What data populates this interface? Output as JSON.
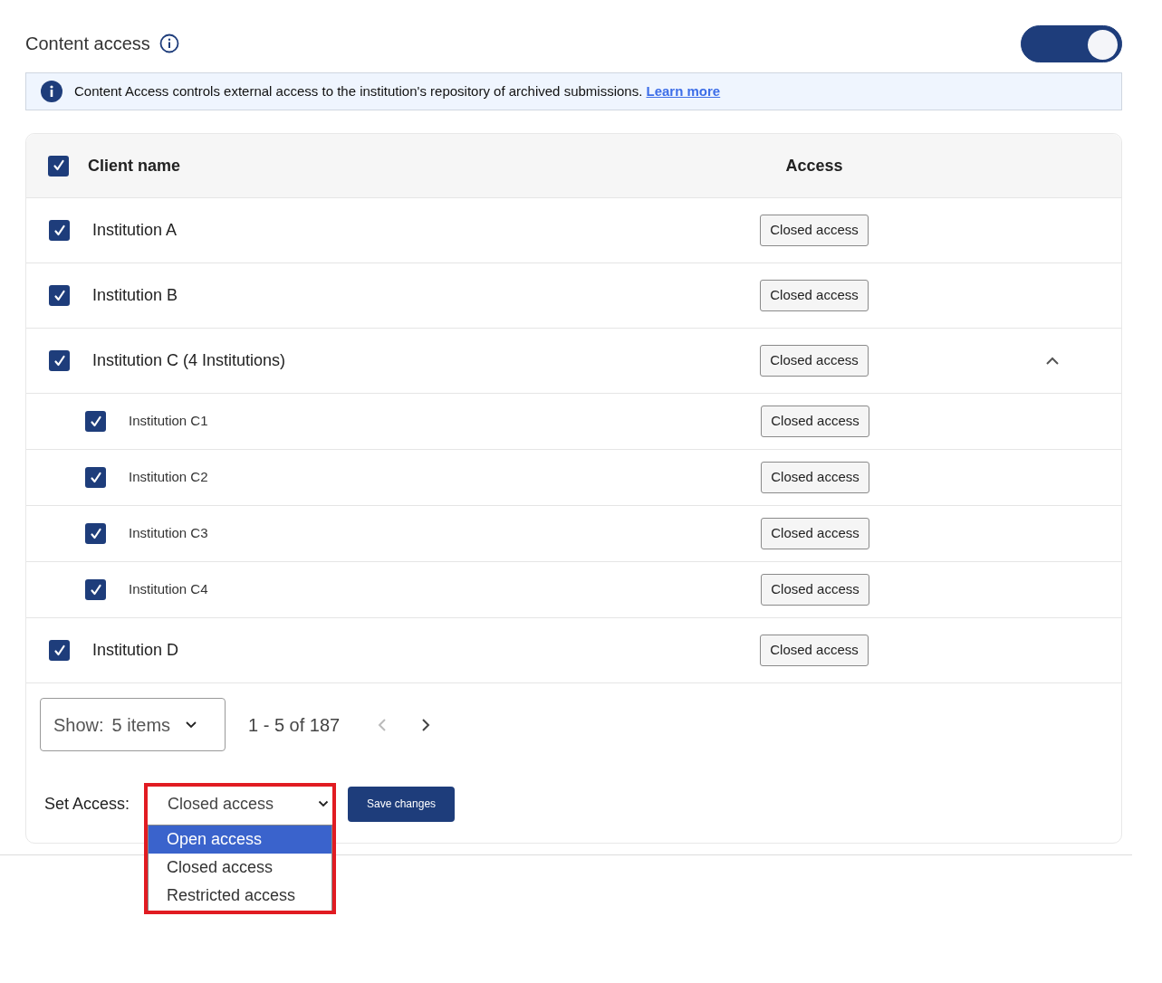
{
  "header": {
    "title": "Content access",
    "toggle": {
      "on": true
    }
  },
  "banner": {
    "text": "Content Access controls external access to the institution's repository of archived submissions.",
    "link": "Learn more"
  },
  "table": {
    "columns": [
      "Client name",
      "Access"
    ],
    "all_checked": true,
    "rows": [
      {
        "name": "Institution A",
        "checked": true,
        "access": "Closed access"
      },
      {
        "name": "Institution B",
        "checked": true,
        "access": "Closed access"
      },
      {
        "name": "Institution C (4 Institutions)",
        "checked": true,
        "access": "Closed access",
        "expanded": true,
        "children": [
          {
            "name": "Institution C1",
            "checked": true,
            "access": "Closed access"
          },
          {
            "name": "Institution C2",
            "checked": true,
            "access": "Closed access"
          },
          {
            "name": "Institution C3",
            "checked": true,
            "access": "Closed access"
          },
          {
            "name": "Institution C4",
            "checked": true,
            "access": "Closed access"
          }
        ]
      },
      {
        "name": "Institution D",
        "checked": true,
        "access": "Closed access"
      }
    ]
  },
  "pagination": {
    "show_label": "Show:",
    "page_size": "5 items",
    "range": "1 - 5 of 187",
    "prev_disabled": true,
    "next_disabled": false
  },
  "set_access": {
    "label": "Set Access:",
    "value": "Closed access",
    "open": true,
    "highlighted": true,
    "options": [
      {
        "label": "Open access",
        "highlighted": true
      },
      {
        "label": "Closed access",
        "highlighted": false
      },
      {
        "label": "Restricted access",
        "highlighted": false
      }
    ],
    "save_button": "Save changes"
  }
}
